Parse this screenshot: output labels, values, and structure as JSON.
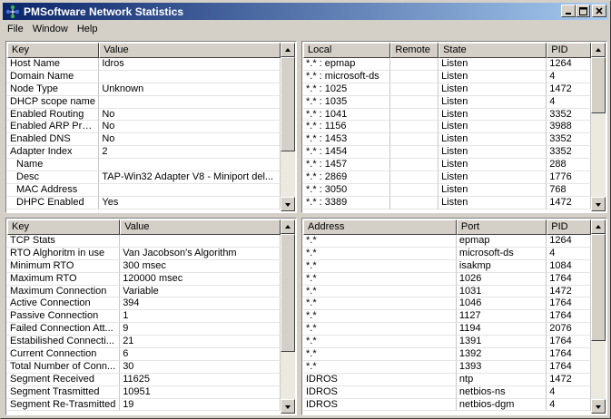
{
  "window": {
    "title": "PMSoftware Network Statistics"
  },
  "menu": [
    "File",
    "Window",
    "Help"
  ],
  "adapter_pane": {
    "columns": [
      "Key",
      "Value"
    ],
    "rows": [
      [
        "Host Name",
        "Idros"
      ],
      [
        "Domain Name",
        ""
      ],
      [
        "Node Type",
        "Unknown"
      ],
      [
        "DHCP scope name",
        ""
      ],
      [
        "Enabled Routing",
        "No"
      ],
      [
        "Enabled ARP Proxy",
        "No"
      ],
      [
        "Enabled DNS",
        "No"
      ],
      [
        "Adapter Index",
        "2"
      ],
      [
        "Name",
        ""
      ],
      [
        "Desc",
        "TAP-Win32 Adapter V8 - Miniport del..."
      ],
      [
        "MAC Address",
        ""
      ],
      [
        "DHPC Enabled",
        "Yes"
      ]
    ]
  },
  "connections_pane": {
    "columns": [
      "Local",
      "Remote",
      "State",
      "PID"
    ],
    "rows": [
      [
        "*.* : epmap",
        "",
        "Listen",
        "1264"
      ],
      [
        "*.* : microsoft-ds",
        "",
        "Listen",
        "4"
      ],
      [
        "*.* : 1025",
        "",
        "Listen",
        "1472"
      ],
      [
        "*.* : 1035",
        "",
        "Listen",
        "4"
      ],
      [
        "*.* : 1041",
        "",
        "Listen",
        "3352"
      ],
      [
        "*.* : 1156",
        "",
        "Listen",
        "3988"
      ],
      [
        "*.* : 1453",
        "",
        "Listen",
        "3352"
      ],
      [
        "*.* : 1454",
        "",
        "Listen",
        "3352"
      ],
      [
        "*.* : 1457",
        "",
        "Listen",
        "288"
      ],
      [
        "*.* : 2869",
        "",
        "Listen",
        "1776"
      ],
      [
        "*.* : 3050",
        "",
        "Listen",
        "768"
      ],
      [
        "*.* : 3389",
        "",
        "Listen",
        "1472"
      ]
    ]
  },
  "tcp_pane": {
    "columns": [
      "Key",
      "Value"
    ],
    "rows": [
      [
        "TCP Stats",
        ""
      ],
      [
        "RTO Alghoritm in use",
        "Van Jacobson's Algorithm"
      ],
      [
        "Minimum RTO",
        "300 msec"
      ],
      [
        "Maximum RTO",
        "120000 msec"
      ],
      [
        "Maximum Connection",
        "Variable"
      ],
      [
        "Active Connection",
        "394"
      ],
      [
        "Passive Connection",
        "1"
      ],
      [
        "Failed Connection Att...",
        "9"
      ],
      [
        "Estabilished Connecti...",
        "21"
      ],
      [
        "Current Connection",
        "6"
      ],
      [
        "Total Number of Conn...",
        "30"
      ],
      [
        "Segment Received",
        "11625"
      ],
      [
        "Segment Trasmitted",
        "10951"
      ],
      [
        "Segment Re-Trasmitted",
        "19"
      ]
    ]
  },
  "ports_pane": {
    "columns": [
      "Address",
      "Port",
      "PID"
    ],
    "rows": [
      [
        "*.*",
        "epmap",
        "1264"
      ],
      [
        "*.*",
        "microsoft-ds",
        "4"
      ],
      [
        "*.*",
        "isakmp",
        "1084"
      ],
      [
        "*.*",
        "1026",
        "1764"
      ],
      [
        "*.*",
        "1031",
        "1472"
      ],
      [
        "*.*",
        "1046",
        "1764"
      ],
      [
        "*.*",
        "1127",
        "1764"
      ],
      [
        "*.*",
        "1194",
        "2076"
      ],
      [
        "*.*",
        "1391",
        "1764"
      ],
      [
        "*.*",
        "1392",
        "1764"
      ],
      [
        "*.*",
        "1393",
        "1764"
      ],
      [
        "IDROS",
        "ntp",
        "1472"
      ],
      [
        "IDROS",
        "netbios-ns",
        "4"
      ],
      [
        "IDROS",
        "netbios-dgm",
        "4"
      ]
    ]
  }
}
